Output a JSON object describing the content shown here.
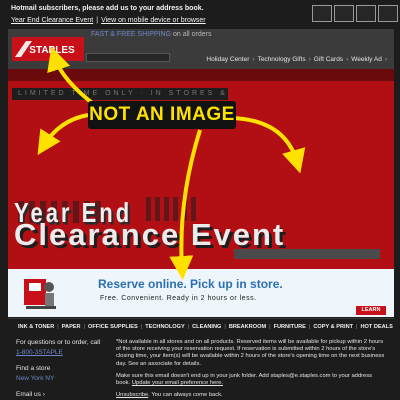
{
  "preheader": {
    "line1": "Hotmail subscribers, please add us to your address book.",
    "link1": "Year End Clearance Event",
    "separator": "|",
    "link2": "View on mobile device or browser"
  },
  "header": {
    "logo_text": "STAPLES",
    "shipping_highlight": "FAST & FREE SHIPPING",
    "shipping_rest": "on all orders",
    "nav_links": [
      "Holiday Center",
      "Technology Gifts",
      "Gift Cards",
      "Weekly Ad"
    ]
  },
  "hero": {
    "pre_text": "LIMITED TIME ONLY · IN STORES & ONLINE",
    "year_text": "Year End",
    "headline": "Clearance Event"
  },
  "annotation": {
    "label": "NOT AN IMAGE",
    "color": "#ffe100"
  },
  "pickup": {
    "title": "Reserve online. Pick up in store.",
    "subtitle": "Free. Convenient. Ready in 2 hours or less.",
    "badge": "LEARN MORE"
  },
  "categories": [
    "INK & TONER",
    "PAPER",
    "OFFICE SUPPLIES",
    "TECHNOLOGY",
    "CLEANING",
    "BREAKROOM",
    "FURNITURE",
    "COPY & PRINT",
    "HOT DEALS"
  ],
  "footer": {
    "questions": "For questions or to order, call",
    "phone": "1-800-3STAPLE",
    "find_store_label": "Find a store",
    "find_store_city": "New York NY",
    "email_label": "Email us",
    "para1": "*Not available in all stores and on all products. Reserved items will be available for pickup within 2 hours of the store receiving your reservation request. If reservation is submitted within 2 hours of the store's closing time, your item(s) will be available within 2 hours of the store's opening time on the next business day. See an associate for details.",
    "para2_pre": "Make sure this email doesn't end up in your junk folder. Add staples@e.staples.com to your address book.",
    "para2_link": "Update your email preference here.",
    "unsubscribe_link": "Unsubscribe",
    "unsubscribe_rest": ". You can always come back."
  },
  "colors": {
    "staples_red": "#c8101a",
    "link_blue": "#6e86c8",
    "pickup_blue": "#2c6fb5"
  }
}
